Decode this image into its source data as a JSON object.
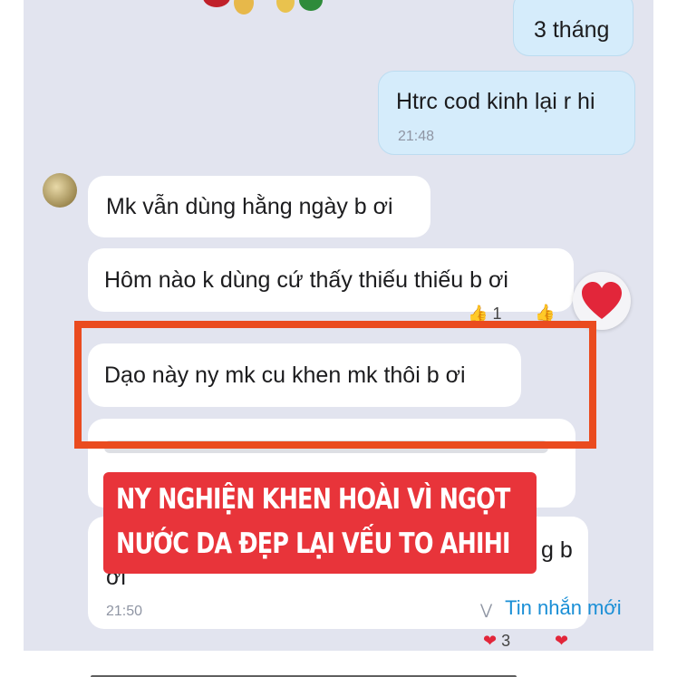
{
  "messages_out": [
    {
      "text": "3 tháng"
    },
    {
      "text": "Htrc cod kinh lại r hi",
      "time": "21:48"
    }
  ],
  "messages_in": [
    {
      "text": "Mk vẫn dùng hằng ngày b ơi"
    },
    {
      "text": "Hôm nào k dùng cứ thấy thiếu thiếu b ơi"
    },
    {
      "text": "Dạo này ny mk cu khen mk thôi b ơi"
    }
  ],
  "partial_message": {
    "tail": "g b",
    "second_line": "ơi",
    "time": "21:50"
  },
  "reactions": {
    "like_count": "1",
    "heart_count": "3"
  },
  "overlay": {
    "line1": "NY NGHIỆN KHEN HOÀI VÌ NGỌT",
    "line2": "NƯỚC DA ĐẸP LẠI VẾU TO AHIHI"
  },
  "new_messages": {
    "label": "Tin nhắn mới"
  },
  "colors": {
    "highlight": "#ea4b1f",
    "overlay": "#e8343a",
    "link": "#1a8fd6"
  }
}
